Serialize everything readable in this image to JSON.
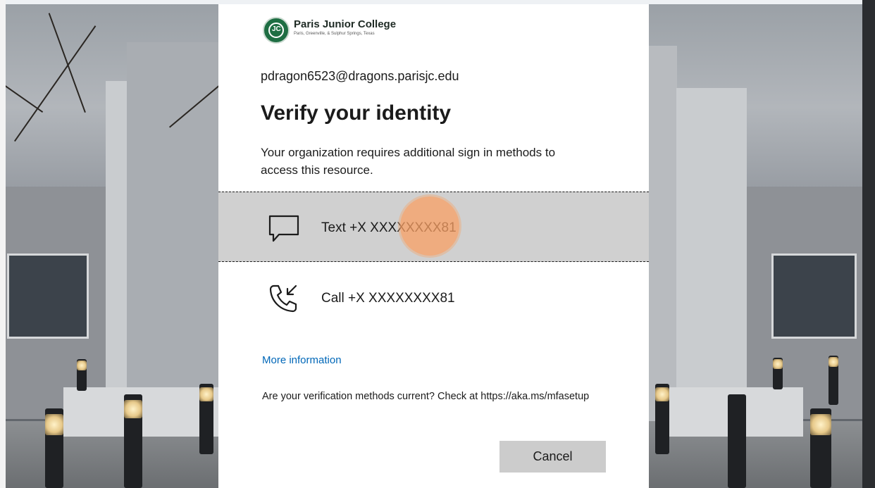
{
  "org": {
    "name": "Paris Junior College",
    "tagline": "Paris, Greenville, & Sulphur Springs, Texas"
  },
  "account": {
    "email": "pdragon6523@dragons.parisjc.edu"
  },
  "heading": {
    "title": "Verify your identity",
    "description": "Your organization requires additional sign in methods to access this resource."
  },
  "methods": [
    {
      "label": "Text +X XXXXXXXX81",
      "icon": "message-icon",
      "selected": true
    },
    {
      "label": "Call +X XXXXXXXX81",
      "icon": "phone-call-icon",
      "selected": false
    }
  ],
  "links": {
    "more_info": "More information"
  },
  "footer": {
    "methods_current": "Are your verification methods current? Check at https://aka.ms/mfasetup"
  },
  "buttons": {
    "cancel": "Cancel"
  },
  "colors": {
    "link": "#0067b8",
    "selected_bg": "#d0d0d0",
    "button_bg": "#cccccc",
    "brand_green": "#1e6e43"
  }
}
